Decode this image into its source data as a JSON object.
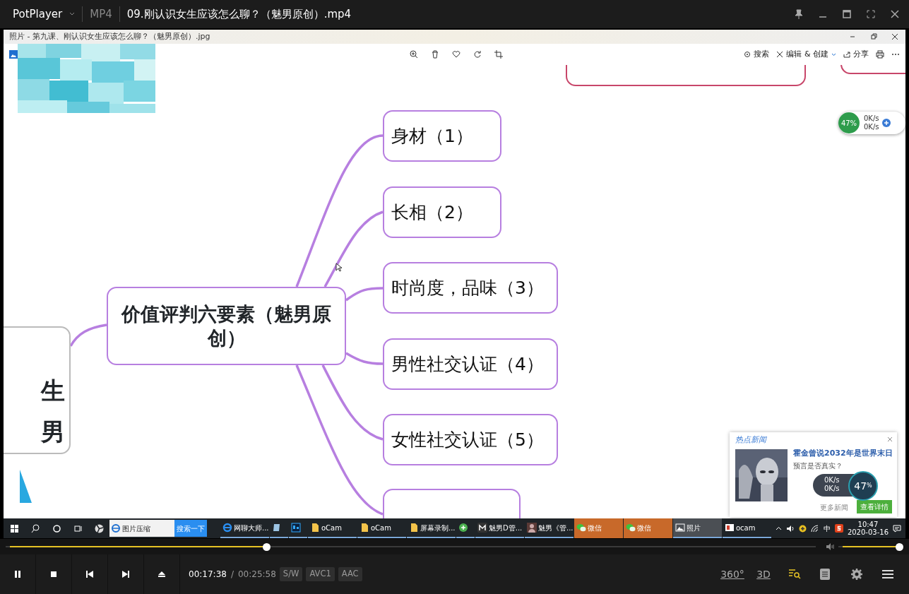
{
  "player": {
    "brand": "PotPlayer",
    "format": "MP4",
    "file_title": "09.刚认识女生应该怎么聊？（魅男原创）.mp4"
  },
  "photos_window": {
    "title": "照片 - 第九课、刚认识女生应该怎么聊？（魅男原创）.jpg",
    "toolbar": [
      {
        "label": "搜索",
        "kind": "search"
      },
      {
        "label": "编辑 & 创建",
        "kind": "edit"
      },
      {
        "label": "分享",
        "kind": "share"
      }
    ]
  },
  "mind_map": {
    "center": "价值评判六要素（魅男原创）",
    "parent_lines": [
      "生",
      "男"
    ],
    "branches": [
      {
        "label": "身材（1）"
      },
      {
        "label": "长相（2）"
      },
      {
        "label": "时尚度，品味（3）"
      },
      {
        "label": "男性社交认证（4）"
      },
      {
        "label": "女性社交认证（5）"
      }
    ]
  },
  "net_widget": {
    "percent": "47%",
    "up": "0K/s",
    "down": "0K/s"
  },
  "news_popup": {
    "header": "热点新闻",
    "headline": "霍金曾说2032年是世界末日",
    "teaser": "预言是否真实？",
    "more": "更多新闻",
    "details": "查看详情"
  },
  "speed_overlay": {
    "up": "0K/s",
    "down": "0K/s",
    "percent": "47",
    "unit": "%"
  },
  "taskbar": {
    "search_text": "图片压缩",
    "search_button": "搜索一下",
    "apps": [
      {
        "kind": "ie",
        "label": "网聊大师...",
        "selected": false,
        "flashing": false
      },
      {
        "kind": "notepad",
        "selected": false,
        "flashing": false
      },
      {
        "kind": "ps",
        "selected": false,
        "flashing": false
      },
      {
        "kind": "folder",
        "label": "oCam",
        "selected": false,
        "flashing": false
      },
      {
        "kind": "folder",
        "label": "oCam",
        "selected": false,
        "flashing": false
      },
      {
        "kind": "folder",
        "label": "屏幕录制...",
        "selected": false,
        "flashing": false
      },
      {
        "kind": "green",
        "selected": false,
        "flashing": false
      },
      {
        "kind": "m",
        "label": "魅男D管...",
        "selected": false,
        "flashing": false
      },
      {
        "kind": "avatar",
        "label": "魅男《管...",
        "selected": false,
        "flashing": false
      },
      {
        "kind": "wechat",
        "label": "微信",
        "selected": false,
        "flashing": true
      },
      {
        "kind": "wechat",
        "label": "微信",
        "selected": false,
        "flashing": true
      },
      {
        "kind": "photos",
        "label": "照片",
        "selected": true,
        "flashing": false
      },
      {
        "kind": "ocam",
        "label": "ocam",
        "selected": false,
        "flashing": false
      }
    ],
    "ime": "中",
    "time": "10:47",
    "date": "2020-03-16"
  },
  "playback": {
    "playing": true,
    "level": 0.32,
    "current": "00:17:38",
    "separator": "/",
    "total": "00:25:58",
    "badges": [
      "S/W",
      "AVC1",
      "AAC"
    ],
    "volume": {
      "level": 1.0
    },
    "mode_buttons": [
      "360°",
      "3D"
    ]
  }
}
